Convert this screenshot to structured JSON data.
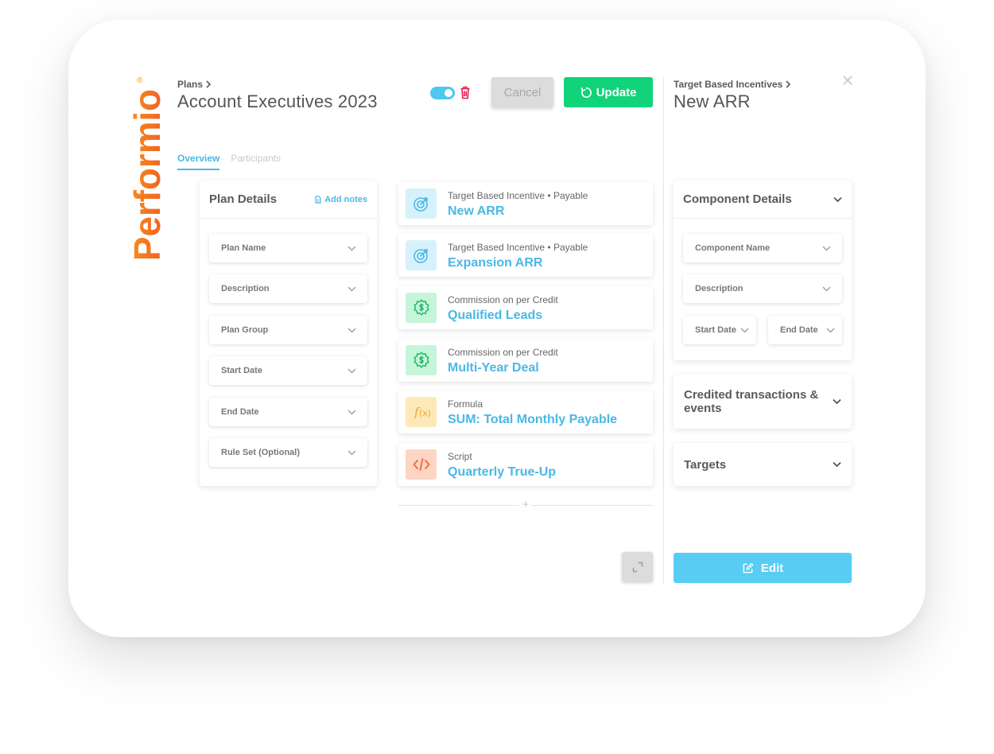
{
  "brand": {
    "name": "Performio",
    "colors": {
      "logo_top": "#f7931e",
      "logo_bottom": "#f15a24",
      "accent": "#4ab8e5",
      "success": "#10d37a",
      "danger": "#e5174f"
    }
  },
  "header": {
    "breadcrumb": "Plans",
    "title": "Account Executives 2023",
    "toggle_on": true,
    "cancel_label": "Cancel",
    "update_label": "Update"
  },
  "tabs": [
    {
      "label": "Overview",
      "active": true
    },
    {
      "label": "Participants",
      "active": false
    }
  ],
  "plan_details": {
    "title": "Plan Details",
    "add_notes_label": "Add notes",
    "fields": [
      "Plan Name",
      "Description",
      "Plan Group",
      "Start Date",
      "End Date",
      "Rule Set (Optional)"
    ]
  },
  "components": [
    {
      "type": "Target Based Incentive • Payable",
      "name": "New ARR",
      "icon": "target-icon",
      "icon_bg": "#d7f1fb",
      "icon_color": "#4ab8e5"
    },
    {
      "type": "Target Based Incentive • Payable",
      "name": "Expansion ARR",
      "icon": "target-icon",
      "icon_bg": "#d7f1fb",
      "icon_color": "#4ab8e5"
    },
    {
      "type": "Commission on per Credit",
      "name": "Qualified Leads",
      "icon": "dollar-gear-icon",
      "icon_bg": "#c6f5da",
      "icon_color": "#12b862"
    },
    {
      "type": "Commission on per Credit",
      "name": "Multi-Year Deal",
      "icon": "dollar-gear-icon",
      "icon_bg": "#c6f5da",
      "icon_color": "#12b862"
    },
    {
      "type": "Formula",
      "name": "SUM: Total Monthly Payable",
      "icon": "function-icon",
      "icon_bg": "#fde9b8",
      "icon_color": "#f5a623"
    },
    {
      "type": "Script",
      "name": "Quarterly True-Up",
      "icon": "code-icon",
      "icon_bg": "#fcd5c4",
      "icon_color": "#f06a35"
    }
  ],
  "add_symbol": "+",
  "right_panel": {
    "breadcrumb": "Target Based Incentives",
    "title": "New ARR",
    "component_details": {
      "title": "Component Details",
      "fields": [
        "Component Name",
        "Description"
      ],
      "start_date": "Start Date",
      "end_date": "End Date"
    },
    "sections": [
      "Credited transactions & events",
      "Targets"
    ],
    "edit_label": "Edit"
  }
}
